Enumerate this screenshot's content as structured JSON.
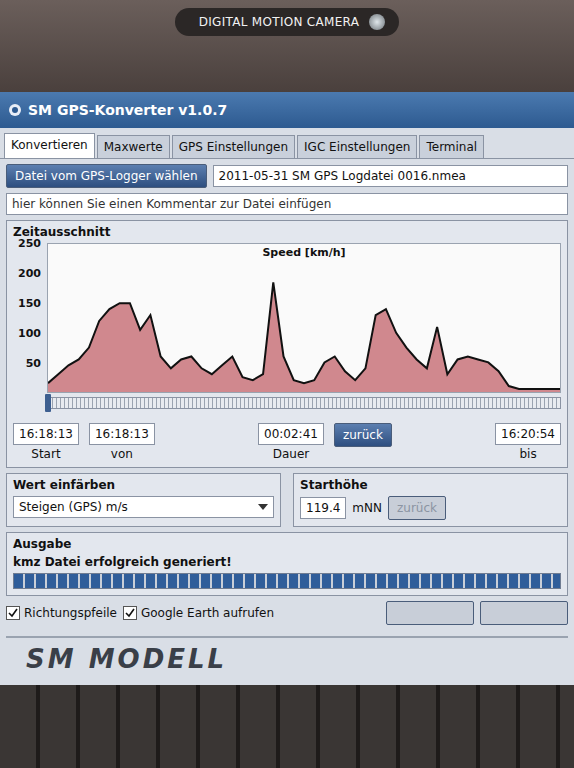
{
  "device": {
    "label": "DIGITAL MOTION CAMERA"
  },
  "window": {
    "title": "SM GPS-Konverter v1.0.7"
  },
  "tabs": [
    {
      "label": "Konvertieren",
      "selected": true
    },
    {
      "label": "Maxwerte",
      "selected": false
    },
    {
      "label": "GPS Einstellungen",
      "selected": false
    },
    {
      "label": "IGC Einstellungen",
      "selected": false
    },
    {
      "label": "Terminal",
      "selected": false
    }
  ],
  "file": {
    "button": "Datei vom GPS-Logger wählen",
    "value": "2011-05-31 SM GPS Logdatei 0016.nmea",
    "comment_placeholder": "hier können Sie einen Kommentar zur Datei einfügen"
  },
  "zeitausschnitt": {
    "title": "Zeitausschnitt",
    "chart": {
      "title": "Speed [km/h]",
      "y_ticks": [
        "250",
        "200",
        "150",
        "100",
        "50"
      ],
      "series": [
        {
          "name": "Speed",
          "values": [
            15,
            30,
            45,
            55,
            75,
            120,
            140,
            150,
            150,
            105,
            130,
            60,
            40,
            55,
            60,
            40,
            30,
            45,
            60,
            25,
            20,
            30,
            185,
            60,
            20,
            15,
            20,
            50,
            60,
            35,
            20,
            40,
            130,
            140,
            100,
            75,
            55,
            40,
            110,
            30,
            55,
            60,
            55,
            50,
            35,
            10,
            5,
            5,
            5,
            5,
            5
          ]
        }
      ]
    },
    "slider": {
      "level": 0
    },
    "fields": [
      {
        "label": "Start",
        "value": "16:18:13"
      },
      {
        "label": "von",
        "value": "16:18:13"
      },
      {
        "label": "Dauer",
        "value": "00:02:41"
      }
    ],
    "back_button": "zurück",
    "end": {
      "label": "bis",
      "value": "16:20:54"
    }
  },
  "wert_einfaerben": {
    "title": "Wert einfärben",
    "value": "Steigen (GPS) m/s"
  },
  "starthoehe": {
    "title": "Starthöhe",
    "value": "119.4",
    "unit": "mNN",
    "button": "zurück",
    "disabled": true
  },
  "ausgabe": {
    "title": "Ausgabe",
    "message": "kmz Datei erfolgreich generiert!",
    "progress": {
      "level": 1
    }
  },
  "options": [
    {
      "label": "Richtungspfeile",
      "checked": true
    },
    {
      "label": "Google Earth aufrufen",
      "checked": true
    }
  ],
  "action_buttons": [
    {
      "disabled": true
    },
    {
      "disabled": true
    }
  ],
  "logo": {
    "text": "SM MODELL"
  }
}
